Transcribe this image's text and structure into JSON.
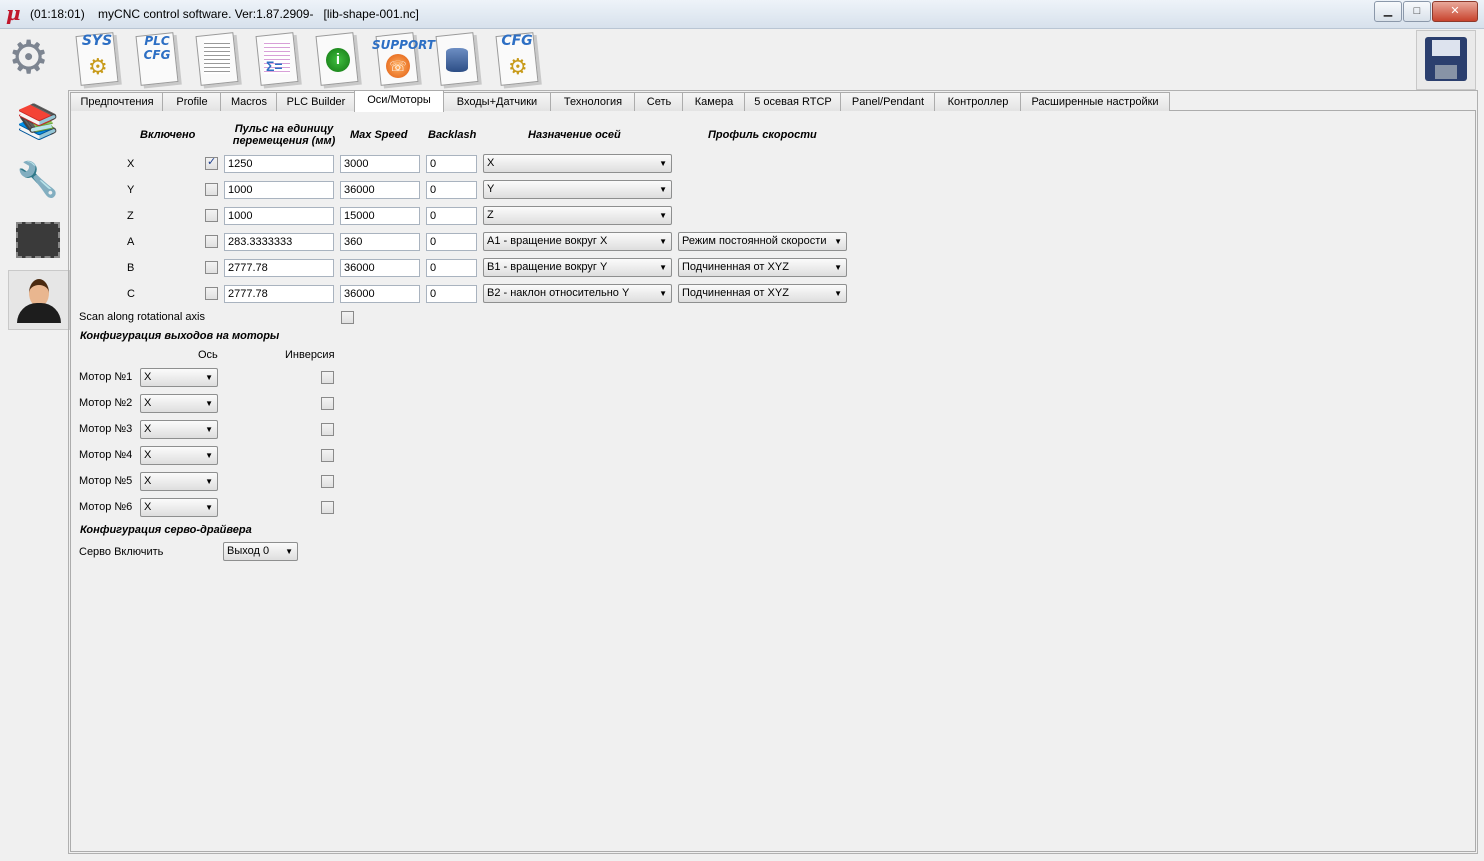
{
  "window": {
    "time": "(01:18:01)",
    "title": "myCNC control software. Ver:1.87.2909-",
    "file": "[lib-shape-001.nc]",
    "minimize": "▁",
    "maximize": "□",
    "close": "✕"
  },
  "toolbar": {
    "sys": "SYS",
    "plc_cfg": "PLC CFG",
    "support": "SUPPORT",
    "cfg": "CFG"
  },
  "tabs": [
    {
      "label": "Предпочтения"
    },
    {
      "label": "Profile"
    },
    {
      "label": "Macros"
    },
    {
      "label": "PLC Builder"
    },
    {
      "label": "Оси/Моторы"
    },
    {
      "label": "Входы+Датчики"
    },
    {
      "label": "Технология"
    },
    {
      "label": "Сеть"
    },
    {
      "label": "Камера"
    },
    {
      "label": "5 осевая RTCP"
    },
    {
      "label": "Panel/Pendant"
    },
    {
      "label": "Контроллер"
    },
    {
      "label": "Расширенные настройки"
    }
  ],
  "axes_table": {
    "headers": {
      "enabled": "Включено",
      "pulses": "Пульс на единицу перемещения (мм)",
      "max_speed": "Max Speed",
      "backlash": "Backlash",
      "assignment": "Назначение осей",
      "profile": "Профиль скорости"
    },
    "rows": [
      {
        "axis": "X",
        "enabled": true,
        "pulses": "1250",
        "max_speed": "3000",
        "backlash": "0",
        "assignment": "X",
        "profile": ""
      },
      {
        "axis": "Y",
        "enabled": false,
        "pulses": "1000",
        "max_speed": "36000",
        "backlash": "0",
        "assignment": "Y",
        "profile": ""
      },
      {
        "axis": "Z",
        "enabled": false,
        "pulses": "1000",
        "max_speed": "15000",
        "backlash": "0",
        "assignment": "Z",
        "profile": ""
      },
      {
        "axis": "A",
        "enabled": false,
        "pulses": "283.3333333",
        "max_speed": "360",
        "backlash": "0",
        "assignment": "A1 - вращение вокруг X",
        "profile": "Режим постоянной скорости"
      },
      {
        "axis": "B",
        "enabled": false,
        "pulses": "2777.78",
        "max_speed": "36000",
        "backlash": "0",
        "assignment": "B1 - вращение вокруг Y",
        "profile": "Подчиненная от XYZ"
      },
      {
        "axis": "C",
        "enabled": false,
        "pulses": "2777.78",
        "max_speed": "36000",
        "backlash": "0",
        "assignment": "B2 - наклон относительно Y",
        "profile": "Подчиненная от XYZ"
      }
    ],
    "scan_rotational_label": "Scan along rotational axis"
  },
  "motors": {
    "section_title": "Конфигурация выходов на моторы",
    "col_axis": "Ось",
    "col_inversion": "Инверсия",
    "rows": [
      {
        "label": "Мотор №1",
        "axis": "X"
      },
      {
        "label": "Мотор №2",
        "axis": "X"
      },
      {
        "label": "Мотор №3",
        "axis": "X"
      },
      {
        "label": "Мотор №4",
        "axis": "X"
      },
      {
        "label": "Мотор №5",
        "axis": "X"
      },
      {
        "label": "Мотор №6",
        "axis": "X"
      }
    ]
  },
  "servo": {
    "section_title": "Конфигурация серво-драйвера",
    "enable_label": "Серво Включить",
    "enable_value": "Выход 0"
  }
}
